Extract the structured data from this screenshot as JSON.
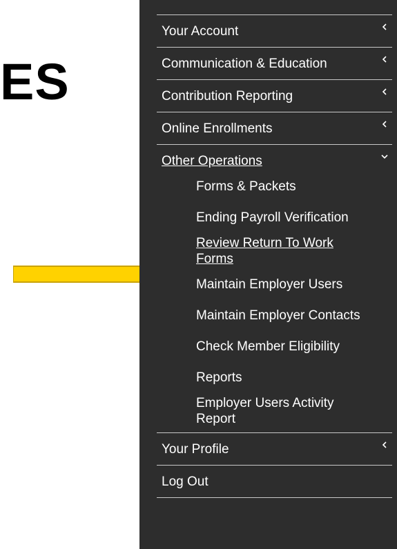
{
  "heading": "ES",
  "menu": {
    "items": [
      {
        "label": "Your Account",
        "chevron": "chevron-left-icon"
      },
      {
        "label": "Communication & Education",
        "chevron": "chevron-left-icon"
      },
      {
        "label": "Contribution Reporting",
        "chevron": "chevron-left-icon"
      },
      {
        "label": "Online Enrollments",
        "chevron": "chevron-left-icon"
      },
      {
        "label": "Other Operations",
        "chevron": "chevron-down-icon"
      },
      {
        "label": "Your Profile",
        "chevron": "chevron-left-icon"
      },
      {
        "label": "Log Out"
      }
    ],
    "other_operations_submenu": [
      {
        "label": "Forms & Packets"
      },
      {
        "label": "Ending Payroll Verification"
      },
      {
        "label": "Review Return To Work Forms"
      },
      {
        "label": "Maintain Employer Users"
      },
      {
        "label": "Maintain Employer Contacts"
      },
      {
        "label": "Check Member Eligibility"
      },
      {
        "label": "Reports"
      },
      {
        "label": "Employer Users Activity Report"
      }
    ]
  },
  "colors": {
    "menu_background": "#2d2d2d",
    "menu_text": "#ffffff",
    "divider": "#c9c9c9",
    "arrow_fill": "#ffd200",
    "arrow_stroke": "#c9a200"
  },
  "annotation": {
    "arrow_icon": "yellow-pointer-arrow-icon"
  }
}
